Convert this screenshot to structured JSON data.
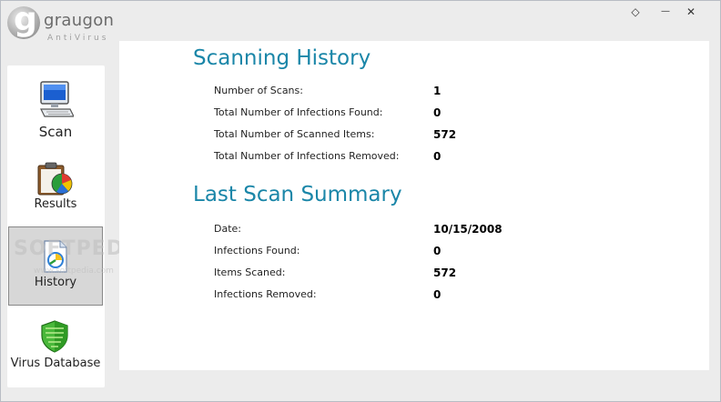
{
  "app": {
    "name": "graugon",
    "tagline": "AntiVirus"
  },
  "window_controls": {
    "restore": "◇",
    "minimize": "—",
    "close": "✕"
  },
  "sidebar": {
    "items": [
      {
        "label": "Scan",
        "icon": "monitor-icon"
      },
      {
        "label": "Results",
        "icon": "clipboard-chart-icon"
      },
      {
        "label": "History",
        "icon": "history-document-icon",
        "active": true
      },
      {
        "label": "Virus Database",
        "icon": "shield-icon"
      }
    ]
  },
  "watermark": {
    "text": "SOFTPEDIA",
    "sub": "www.softpedia.com"
  },
  "scanning_history": {
    "title": "Scanning History",
    "rows": [
      {
        "label": "Number of Scans:",
        "value": "1"
      },
      {
        "label": "Total Number of Infections Found:",
        "value": "0"
      },
      {
        "label": "Total Number of Scanned Items:",
        "value": "572"
      },
      {
        "label": "Total Number of Infections Removed:",
        "value": "0"
      }
    ]
  },
  "last_scan": {
    "title": "Last Scan Summary",
    "rows": [
      {
        "label": "Date:",
        "value": "10/15/2008"
      },
      {
        "label": "Infections Found:",
        "value": "0"
      },
      {
        "label": "Items Scaned:",
        "value": "572"
      },
      {
        "label": "Infections Removed:",
        "value": "0"
      }
    ]
  }
}
